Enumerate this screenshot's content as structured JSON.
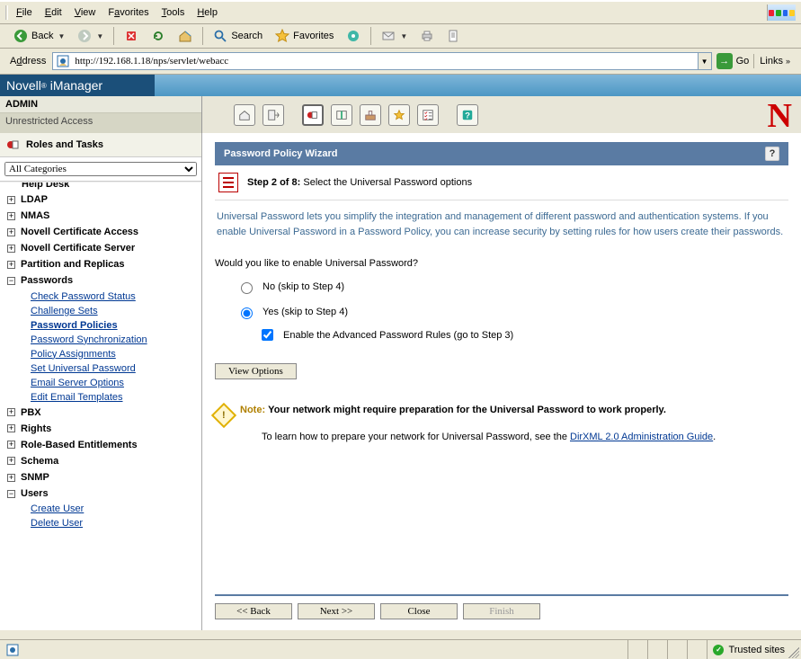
{
  "menubar": [
    "File",
    "Edit",
    "View",
    "Favorites",
    "Tools",
    "Help"
  ],
  "ie_toolbar": {
    "back": "Back",
    "search": "Search",
    "favorites": "Favorites"
  },
  "addressbar": {
    "label": "Address",
    "url": "http://192.168.1.18/nps/servlet/webacc",
    "go": "Go",
    "links": "Links"
  },
  "banner": {
    "brand": "Novell",
    "app": "iManager"
  },
  "admin": {
    "name": "ADMIN",
    "sub": "Unrestricted Access"
  },
  "sidebar": {
    "head": "Roles and Tasks",
    "category_sel": "All Categories",
    "topcut": "Help Desk",
    "items": [
      {
        "label": "LDAP",
        "pm": "+",
        "open": false
      },
      {
        "label": "NMAS",
        "pm": "+",
        "open": false
      },
      {
        "label": "Novell Certificate Access",
        "pm": "+",
        "open": false
      },
      {
        "label": "Novell Certificate Server",
        "pm": "+",
        "open": false
      },
      {
        "label": "Partition and Replicas",
        "pm": "+",
        "open": false
      },
      {
        "label": "Passwords",
        "pm": "−",
        "open": true,
        "subs": [
          {
            "label": "Check Password Status"
          },
          {
            "label": "Challenge Sets"
          },
          {
            "label": "Password Policies",
            "active": true
          },
          {
            "label": "Password Synchronization"
          },
          {
            "label": "Policy Assignments"
          },
          {
            "label": "Set Universal Password"
          },
          {
            "label": "Email Server Options"
          },
          {
            "label": "Edit Email Templates"
          }
        ]
      },
      {
        "label": "PBX",
        "pm": "+",
        "open": false
      },
      {
        "label": "Rights",
        "pm": "+",
        "open": false
      },
      {
        "label": "Role-Based Entitlements",
        "pm": "+",
        "open": false
      },
      {
        "label": "Schema",
        "pm": "+",
        "open": false
      },
      {
        "label": "SNMP",
        "pm": "+",
        "open": false
      },
      {
        "label": "Users",
        "pm": "−",
        "open": true,
        "subs": [
          {
            "label": "Create User"
          },
          {
            "label": "Delete User"
          }
        ]
      }
    ]
  },
  "wizard": {
    "title": "Password Policy Wizard",
    "step_label": "Step 2 of 8:",
    "step_desc": "Select the Universal Password options",
    "desc": "Universal Password lets you simplify the integration and management of different password and authentication systems. If you enable Universal Password in a Password Policy, you can increase security by setting rules for how users create their passwords.",
    "question": "Would you like to enable Universal Password?",
    "opts": {
      "no": "No   (skip to Step 4)",
      "yes": "Yes   (skip to Step 4)",
      "adv": "Enable the Advanced Password Rules  (go to Step 3)"
    },
    "view_options": "View Options",
    "note_head": "Note:",
    "note_bold": "Your network might require preparation for the Universal Password to work properly.",
    "note_body": "To learn how to prepare your network for Universal Password, see the ",
    "note_link": "DirXML 2.0 Administration Guide",
    "buttons": {
      "back": "<< Back",
      "next": "Next >>",
      "close": "Close",
      "finish": "Finish"
    }
  },
  "status": {
    "trusted": "Trusted sites"
  }
}
